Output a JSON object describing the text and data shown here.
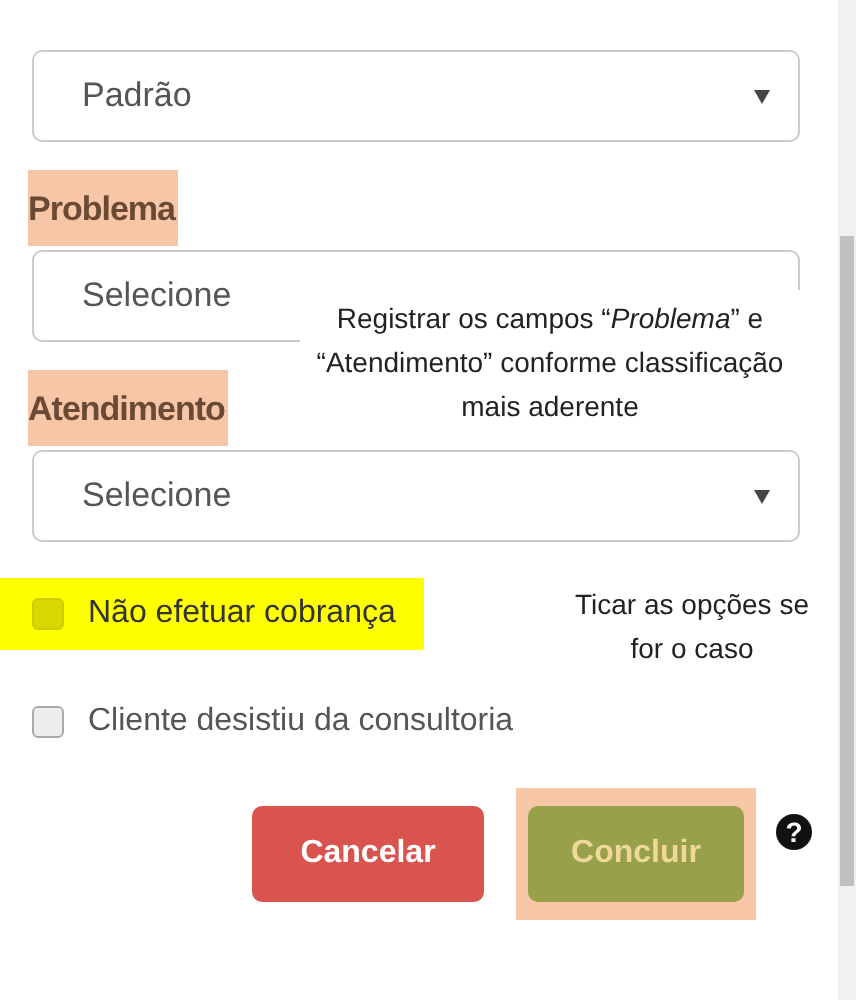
{
  "fields": [
    {
      "value": "Padrão",
      "caret": true
    },
    {
      "label": "Problema",
      "value": "Selecione",
      "highlighted": true,
      "caret": false
    },
    {
      "label": "Atendimento",
      "value": "Selecione",
      "highlighted": true,
      "caret": true
    }
  ],
  "note_fields": "Registrar os campos “*Problema*” e “Atendimento” conforme classificação mais aderente",
  "checkboxes": [
    {
      "label": "Não efetuar cobrança",
      "checked": false,
      "highlighted": true
    },
    {
      "label": "Cliente desistiu da consultoria",
      "checked": false,
      "highlighted": false
    }
  ],
  "note_checkboxes": "Ticar as opções se for o caso",
  "buttons": [
    {
      "label": "Cancelar",
      "kind": "danger",
      "highlighted": false
    },
    {
      "label": "Concluir",
      "kind": "success",
      "highlighted": true
    }
  ],
  "help": "?"
}
